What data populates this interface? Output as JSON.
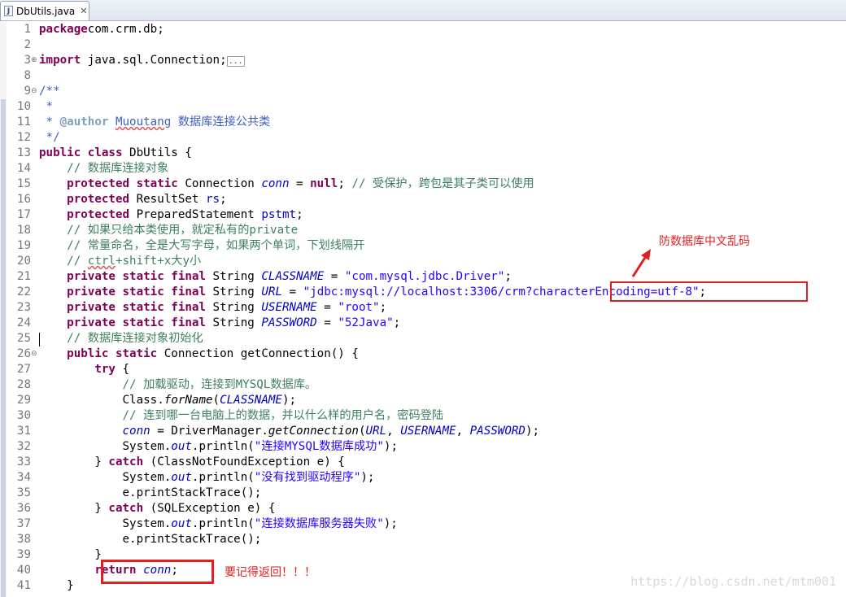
{
  "tab": {
    "icon": "J",
    "label": "DbUtils.java",
    "close": "✕"
  },
  "lines": [
    {
      "n": "1",
      "fold": "",
      "seg": [
        [
          "kw",
          "package"
        ],
        [
          "",
          "com.crm.db;"
        ]
      ]
    },
    {
      "n": "2",
      "fold": "",
      "seg": []
    },
    {
      "n": "3",
      "fold": "⊕",
      "seg": [
        [
          "kw",
          "import"
        ],
        [
          "",
          " java.sql.Connection;"
        ],
        [
          "folded",
          "..."
        ]
      ]
    },
    {
      "n": "8",
      "fold": "",
      "seg": []
    },
    {
      "n": "9",
      "fold": "⊖",
      "seg": [
        [
          "jd",
          "/**"
        ]
      ]
    },
    {
      "n": "10",
      "fold": "",
      "seg": [
        [
          "jd",
          " *"
        ]
      ]
    },
    {
      "n": "11",
      "fold": "",
      "seg": [
        [
          "jd",
          " * "
        ],
        [
          "tag",
          "@author"
        ],
        [
          "jd",
          " "
        ],
        [
          "jd squig",
          "Muoutang"
        ],
        [
          "jd",
          " 数据库连接公共类"
        ]
      ]
    },
    {
      "n": "12",
      "fold": "",
      "seg": [
        [
          "jd",
          " */"
        ]
      ]
    },
    {
      "n": "13",
      "fold": "",
      "seg": [
        [
          "kw",
          "public class"
        ],
        [
          "",
          " DbUtils {"
        ]
      ]
    },
    {
      "n": "14",
      "fold": "",
      "seg": [
        [
          "",
          "    "
        ],
        [
          "cm",
          "// 数据库连接对象"
        ]
      ]
    },
    {
      "n": "15",
      "fold": "",
      "seg": [
        [
          "",
          "    "
        ],
        [
          "kw",
          "protected static"
        ],
        [
          "",
          " Connection "
        ],
        [
          "fld si",
          "conn"
        ],
        [
          "",
          " = "
        ],
        [
          "kw",
          "null"
        ],
        [
          "",
          "; "
        ],
        [
          "cm",
          "// 受保护，跨包是其子类可以使用"
        ]
      ]
    },
    {
      "n": "16",
      "fold": "",
      "seg": [
        [
          "",
          "    "
        ],
        [
          "kw",
          "protected"
        ],
        [
          "",
          " ResultSet "
        ],
        [
          "fld",
          "rs"
        ],
        [
          "",
          ";"
        ]
      ]
    },
    {
      "n": "17",
      "fold": "",
      "seg": [
        [
          "",
          "    "
        ],
        [
          "kw",
          "protected"
        ],
        [
          "",
          " PreparedStatement "
        ],
        [
          "fld",
          "pstmt"
        ],
        [
          "",
          ";"
        ]
      ]
    },
    {
      "n": "18",
      "fold": "",
      "seg": [
        [
          "",
          "    "
        ],
        [
          "cm",
          "// 如果只给本类使用，就定私有的private"
        ]
      ]
    },
    {
      "n": "19",
      "fold": "",
      "seg": [
        [
          "",
          "    "
        ],
        [
          "cm",
          "// 常量命名，全是大写字母，如果两个单词，下划线隔开"
        ]
      ]
    },
    {
      "n": "20",
      "fold": "",
      "seg": [
        [
          "",
          "    "
        ],
        [
          "cm",
          "// "
        ],
        [
          "cm squig",
          "ctrl"
        ],
        [
          "cm",
          "+shift+x大y小"
        ]
      ]
    },
    {
      "n": "21",
      "fold": "",
      "seg": [
        [
          "",
          "    "
        ],
        [
          "kw",
          "private static final"
        ],
        [
          "",
          " String "
        ],
        [
          "sfi",
          "CLASSNAME"
        ],
        [
          "",
          " = "
        ],
        [
          "str",
          "\"com.mysql.jdbc.Driver\""
        ],
        [
          "",
          ";"
        ]
      ]
    },
    {
      "n": "22",
      "fold": "",
      "seg": [
        [
          "",
          "    "
        ],
        [
          "kw",
          "private static final"
        ],
        [
          "",
          " String "
        ],
        [
          "sfi",
          "URL"
        ],
        [
          "",
          " = "
        ],
        [
          "str",
          "\"jdbc:mysql://localhost:3306/crm?characterEncoding=utf-8\""
        ],
        [
          "",
          ";"
        ]
      ]
    },
    {
      "n": "23",
      "fold": "",
      "seg": [
        [
          "",
          "    "
        ],
        [
          "kw",
          "private static final"
        ],
        [
          "",
          " String "
        ],
        [
          "sfi",
          "USERNAME"
        ],
        [
          "",
          " = "
        ],
        [
          "str",
          "\"root\""
        ],
        [
          "",
          ";"
        ]
      ]
    },
    {
      "n": "24",
      "fold": "",
      "seg": [
        [
          "",
          "    "
        ],
        [
          "kw",
          "private static final"
        ],
        [
          "",
          " String "
        ],
        [
          "sfi",
          "PASSWORD"
        ],
        [
          "",
          " = "
        ],
        [
          "str",
          "\"52Java\""
        ],
        [
          "",
          ";"
        ]
      ]
    },
    {
      "n": "25",
      "fold": "",
      "seg": [
        [
          "",
          "    "
        ],
        [
          "cm",
          "// 数据库连接对象初始化"
        ]
      ]
    },
    {
      "n": "26",
      "fold": "⊖",
      "seg": [
        [
          "",
          "    "
        ],
        [
          "kw",
          "public static"
        ],
        [
          "",
          " Connection getConnection() {"
        ]
      ]
    },
    {
      "n": "27",
      "fold": "",
      "seg": [
        [
          "",
          "        "
        ],
        [
          "kw",
          "try"
        ],
        [
          "",
          " {"
        ]
      ]
    },
    {
      "n": "28",
      "fold": "",
      "seg": [
        [
          "",
          "            "
        ],
        [
          "cm",
          "// 加载驱动，连接到MYSQL数据库。"
        ]
      ]
    },
    {
      "n": "29",
      "fold": "",
      "seg": [
        [
          "",
          "            Class."
        ],
        [
          "si",
          "forName"
        ],
        [
          "",
          "("
        ],
        [
          "sfi",
          "CLASSNAME"
        ],
        [
          "",
          ");"
        ]
      ]
    },
    {
      "n": "30",
      "fold": "",
      "seg": [
        [
          "",
          "            "
        ],
        [
          "cm",
          "// 连到哪一台电脑上的数据，并以什么样的用户名，密码登陆"
        ]
      ]
    },
    {
      "n": "31",
      "fold": "",
      "seg": [
        [
          "",
          "            "
        ],
        [
          "fld si",
          "conn"
        ],
        [
          "",
          " = DriverManager."
        ],
        [
          "si",
          "getConnection"
        ],
        [
          "",
          "("
        ],
        [
          "sfi",
          "URL"
        ],
        [
          "",
          ", "
        ],
        [
          "sfi",
          "USERNAME"
        ],
        [
          "",
          ", "
        ],
        [
          "sfi",
          "PASSWORD"
        ],
        [
          "",
          ");"
        ]
      ]
    },
    {
      "n": "32",
      "fold": "",
      "seg": [
        [
          "",
          "            System."
        ],
        [
          "sfi",
          "out"
        ],
        [
          "",
          ".println("
        ],
        [
          "str",
          "\"连接MYSQL数据库成功\""
        ],
        [
          "",
          ");"
        ]
      ]
    },
    {
      "n": "33",
      "fold": "",
      "seg": [
        [
          "",
          "        } "
        ],
        [
          "kw",
          "catch"
        ],
        [
          "",
          " (ClassNotFoundException e) {"
        ]
      ]
    },
    {
      "n": "34",
      "fold": "",
      "seg": [
        [
          "",
          "            System."
        ],
        [
          "sfi",
          "out"
        ],
        [
          "",
          ".println("
        ],
        [
          "str",
          "\"没有找到驱动程序\""
        ],
        [
          "",
          ");"
        ]
      ]
    },
    {
      "n": "35",
      "fold": "",
      "seg": [
        [
          "",
          "            e.printStackTrace();"
        ]
      ]
    },
    {
      "n": "36",
      "fold": "",
      "seg": [
        [
          "",
          "        } "
        ],
        [
          "kw",
          "catch"
        ],
        [
          "",
          " (SQLException e) {"
        ]
      ]
    },
    {
      "n": "37",
      "fold": "",
      "seg": [
        [
          "",
          "            System."
        ],
        [
          "sfi",
          "out"
        ],
        [
          "",
          ".println("
        ],
        [
          "str",
          "\"连接数据库服务器失败\""
        ],
        [
          "",
          ");"
        ]
      ]
    },
    {
      "n": "38",
      "fold": "",
      "seg": [
        [
          "",
          "            e.printStackTrace();"
        ]
      ]
    },
    {
      "n": "39",
      "fold": "",
      "seg": [
        [
          "",
          "        }"
        ]
      ]
    },
    {
      "n": "40",
      "fold": "",
      "seg": [
        [
          "",
          "        "
        ],
        [
          "kw",
          "return"
        ],
        [
          "",
          " "
        ],
        [
          "fld si",
          "conn"
        ],
        [
          "",
          ";"
        ]
      ]
    },
    {
      "n": "41",
      "fold": "",
      "seg": [
        [
          "",
          "    }"
        ]
      ]
    }
  ],
  "annotations": {
    "encoding_note": "防数据库中文乱码",
    "return_note": "要记得返回！！！"
  },
  "watermark": "https://blog.csdn.net/mtm001",
  "colors": {
    "annotation": "#e21f1f",
    "keyword": "#7f0055",
    "comment": "#3f7f5f",
    "string": "#2a00ff",
    "field": "#0000c0"
  }
}
